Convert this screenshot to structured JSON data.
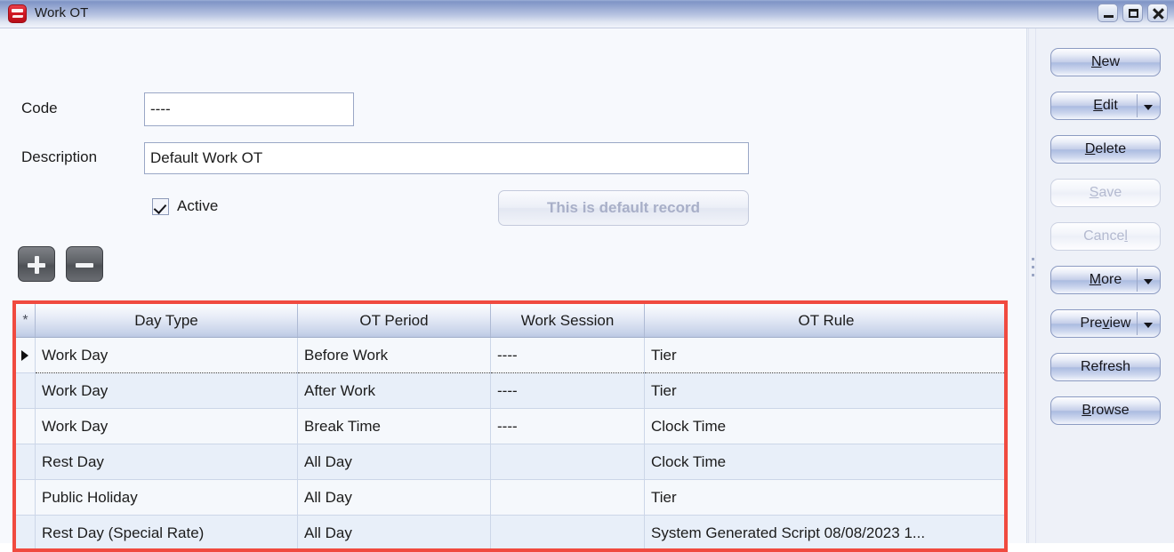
{
  "window": {
    "title": "Work OT",
    "app_icon": "app-red-icon",
    "controls": {
      "minimize": "minimize-icon",
      "maximize": "maximize-icon",
      "close": "close-icon"
    }
  },
  "form": {
    "code_label": "Code",
    "code_value": "----",
    "description_label": "Description",
    "description_value": "Default Work OT",
    "active_label": "Active",
    "active_checked": true,
    "default_record_button": "This is default record"
  },
  "toolbar": {
    "add_label": "+",
    "remove_label": "-"
  },
  "grid": {
    "selector_header": "*",
    "columns": [
      "Day Type",
      "OT Period",
      "Work Session",
      "OT Rule"
    ],
    "rows": [
      {
        "day_type": "Work Day",
        "ot_period": "Before Work",
        "work_session": "----",
        "ot_rule": "Tier",
        "current": true
      },
      {
        "day_type": "Work Day",
        "ot_period": "After Work",
        "work_session": "----",
        "ot_rule": "Tier",
        "current": false
      },
      {
        "day_type": "Work Day",
        "ot_period": "Break Time",
        "work_session": "----",
        "ot_rule": "Clock Time",
        "current": false
      },
      {
        "day_type": "Rest Day",
        "ot_period": "All Day",
        "work_session": "",
        "ot_rule": "Clock Time",
        "current": false
      },
      {
        "day_type": "Public Holiday",
        "ot_period": "All Day",
        "work_session": "",
        "ot_rule": "Tier",
        "current": false
      },
      {
        "day_type": "Rest Day (Special Rate)",
        "ot_period": "All Day",
        "work_session": "",
        "ot_rule": "System Generated Script 08/08/2023 1...",
        "current": false
      }
    ]
  },
  "sidebar": {
    "buttons": [
      {
        "label": "New",
        "mnemonic": "N",
        "dropdown": false,
        "disabled": false
      },
      {
        "label": "Edit",
        "mnemonic": "E",
        "dropdown": true,
        "disabled": false
      },
      {
        "label": "Delete",
        "mnemonic": "D",
        "dropdown": false,
        "disabled": false
      },
      {
        "label": "Save",
        "mnemonic": "S",
        "dropdown": false,
        "disabled": true
      },
      {
        "label": "Cancel",
        "mnemonic": "l",
        "dropdown": false,
        "disabled": true
      },
      {
        "label": "More",
        "mnemonic": "M",
        "dropdown": true,
        "disabled": false
      },
      {
        "label": "Preview",
        "mnemonic": "v",
        "dropdown": true,
        "disabled": false
      },
      {
        "label": "Refresh",
        "mnemonic": "",
        "dropdown": false,
        "disabled": false
      },
      {
        "label": "Browse",
        "mnemonic": "B",
        "dropdown": false,
        "disabled": false
      }
    ]
  },
  "colors": {
    "grid_highlight": "#f04a3f",
    "titlebar_blue": "#7f94c6",
    "accent_button": "#aabbe0"
  }
}
